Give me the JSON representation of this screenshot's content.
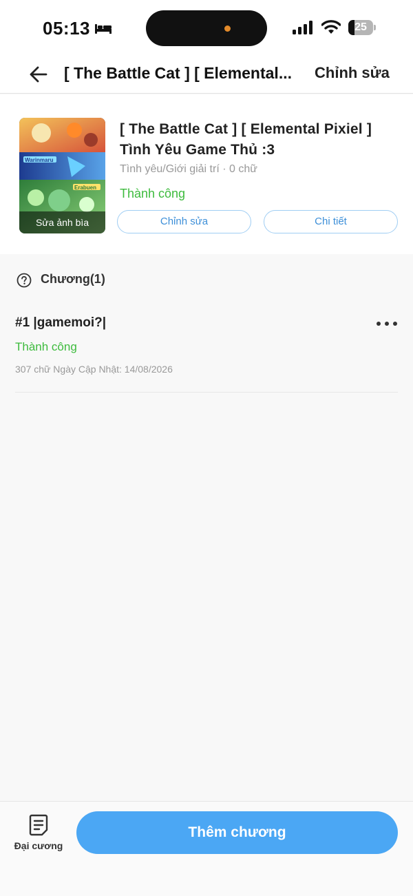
{
  "status_bar": {
    "time": "05:13",
    "battery_level": 25,
    "battery_text": "25",
    "icons": [
      "bed-icon",
      "signal-icon",
      "wifi-icon",
      "battery-icon"
    ]
  },
  "header": {
    "title": "[ The Battle Cat ] [ Elemental...",
    "edit_label": "Chỉnh sửa"
  },
  "book": {
    "title": "[ The Battle Cat ] [ Elemental Pixiel ] Tình Yêu Game Thủ :3",
    "meta": "Tình yêu/Giới giải trí · 0 chữ",
    "status": "Thành công",
    "cover_caption": "Sửa ảnh bìa",
    "cover_labels": [
      "Warinmaru",
      "Erabuen"
    ],
    "edit_button": "Chỉnh sửa",
    "detail_button": "Chi tiết"
  },
  "chapters_section": {
    "title": "Chương(1)",
    "chapters": [
      {
        "title": "#1 |gamemoi?|",
        "status": "Thành công",
        "meta": "307 chữ Ngày Cập Nhật: 14/08/2026"
      }
    ]
  },
  "bottom_bar": {
    "outline_label": "Đại cương",
    "add_chapter_label": "Thêm chương"
  },
  "colors": {
    "accent_blue": "#4ba7f4",
    "success_green": "#3dbb3d",
    "muted_text": "#999999"
  }
}
